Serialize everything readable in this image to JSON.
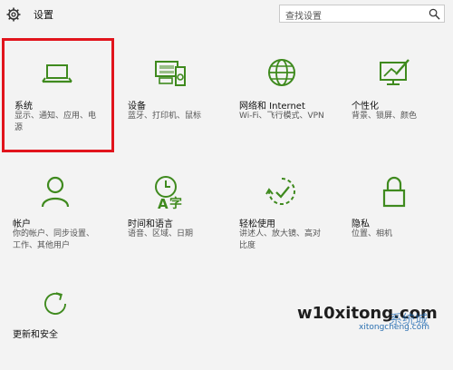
{
  "header": {
    "title": "设置",
    "search_placeholder": "查找设置"
  },
  "tiles": [
    {
      "name": "系统",
      "desc1": "显示、通知、应用、电",
      "desc2": "源",
      "icon": "laptop-icon"
    },
    {
      "name": "设备",
      "desc1": "蓝牙、打印机、鼠标",
      "desc2": "",
      "icon": "devices-icon"
    },
    {
      "name": "网络和 Internet",
      "desc1": "Wi-Fi、飞行模式、VPN",
      "desc2": "",
      "icon": "globe-icon"
    },
    {
      "name": "个性化",
      "desc1": "背景、锁屏、颜色",
      "desc2": "",
      "icon": "personalization-icon"
    },
    {
      "name": "帐户",
      "desc1": "你的帐户、同步设置、",
      "desc2": "工作、其他用户",
      "icon": "person-icon"
    },
    {
      "name": "时间和语言",
      "desc1": "语音、区域、日期",
      "desc2": "",
      "icon": "time-language-icon"
    },
    {
      "name": "轻松使用",
      "desc1": "讲述人、放大镜、高对",
      "desc2": "比度",
      "icon": "ease-of-access-icon"
    },
    {
      "name": "隐私",
      "desc1": "位置、相机",
      "desc2": "",
      "icon": "lock-icon"
    },
    {
      "name": "更新和安全",
      "desc1": "",
      "desc2": "",
      "icon": "update-icon"
    }
  ],
  "watermark": {
    "text": "w10xitong.com",
    "sub": "xitongcheng.com",
    "cn": "系统城"
  },
  "colors": {
    "accent": "#3f8a1e",
    "highlight": "#e1141c",
    "background": "#f3f3f3"
  }
}
